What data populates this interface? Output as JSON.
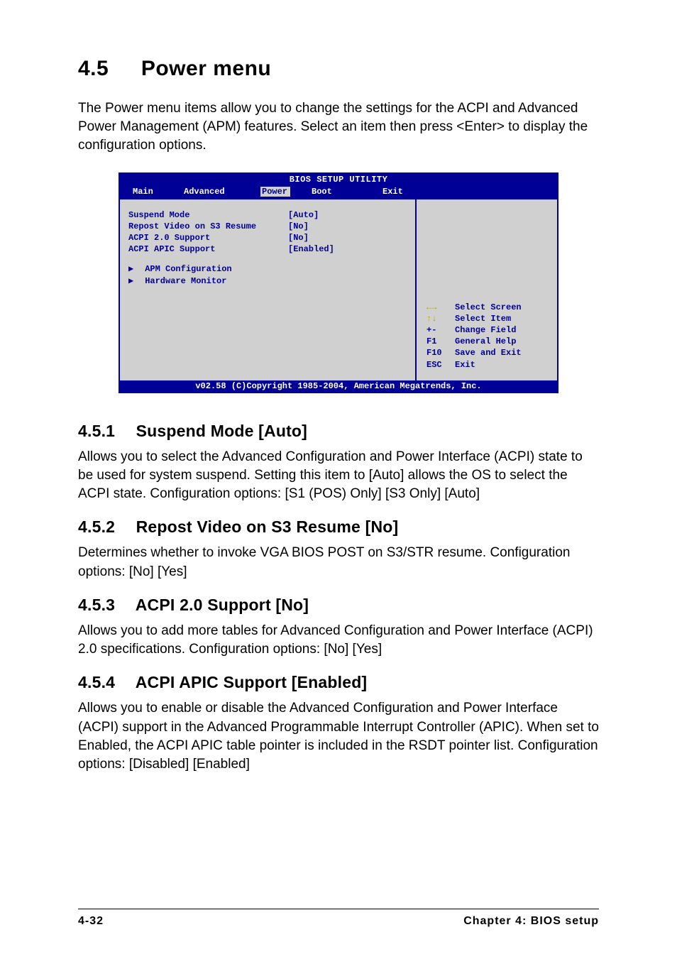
{
  "section": {
    "number": "4.5",
    "title": "Power menu"
  },
  "intro": "The Power menu items allow you to change the settings for the ACPI and Advanced Power Management (APM) features. Select an item then press <Enter> to display the configuration options.",
  "bios": {
    "title": "BIOS SETUP UTILITY",
    "tabs": {
      "main": "Main",
      "advanced": "Advanced",
      "power": "Power",
      "boot": "Boot",
      "exit": "Exit"
    },
    "items": [
      {
        "label": "Suspend Mode",
        "value": "[Auto]"
      },
      {
        "label": "Repost Video on S3 Resume",
        "value": "[No]"
      },
      {
        "label": "ACPI 2.0 Support",
        "value": "[No]"
      },
      {
        "label": "ACPI APIC Support",
        "value": "[Enabled]"
      }
    ],
    "submenus": [
      "APM Configuration",
      "Hardware Monitor"
    ],
    "help": [
      {
        "key": "←→",
        "desc": "Select Screen",
        "yellow": true
      },
      {
        "key": "↑↓",
        "desc": "Select Item",
        "yellow": true
      },
      {
        "key": "+-",
        "desc": "Change Field",
        "yellow": false
      },
      {
        "key": "F1",
        "desc": "General Help",
        "yellow": false
      },
      {
        "key": "F10",
        "desc": "Save and Exit",
        "yellow": false
      },
      {
        "key": "ESC",
        "desc": "Exit",
        "yellow": false
      }
    ],
    "footer": "v02.58 (C)Copyright 1985-2004, American Megatrends, Inc."
  },
  "subsections": [
    {
      "num": "4.5.1",
      "title": "Suspend Mode [Auto]",
      "text": "Allows you to select the Advanced Configuration and Power Interface (ACPI) state to be used for system suspend. Setting this item to [Auto] allows the OS to select the ACPI state. Configuration options: [S1 (POS) Only] [S3 Only] [Auto]"
    },
    {
      "num": "4.5.2",
      "title": "Repost Video on S3 Resume [No]",
      "text": "Determines whether to invoke VGA BIOS POST on S3/STR resume. Configuration options: [No] [Yes]"
    },
    {
      "num": "4.5.3",
      "title": "ACPI 2.0 Support [No]",
      "text": "Allows you to add more tables for Advanced Configuration and Power Interface (ACPI) 2.0 specifications. Configuration options: [No] [Yes]"
    },
    {
      "num": "4.5.4",
      "title": "ACPI APIC Support [Enabled]",
      "text": "Allows you to enable or disable the Advanced Configuration and Power Interface (ACPI) support in the Advanced Programmable Interrupt Controller (APIC). When set to Enabled, the ACPI APIC table pointer is included in the RSDT pointer list. Configuration options: [Disabled] [Enabled]"
    }
  ],
  "footer": {
    "left": "4-32",
    "right": "Chapter 4: BIOS setup"
  }
}
